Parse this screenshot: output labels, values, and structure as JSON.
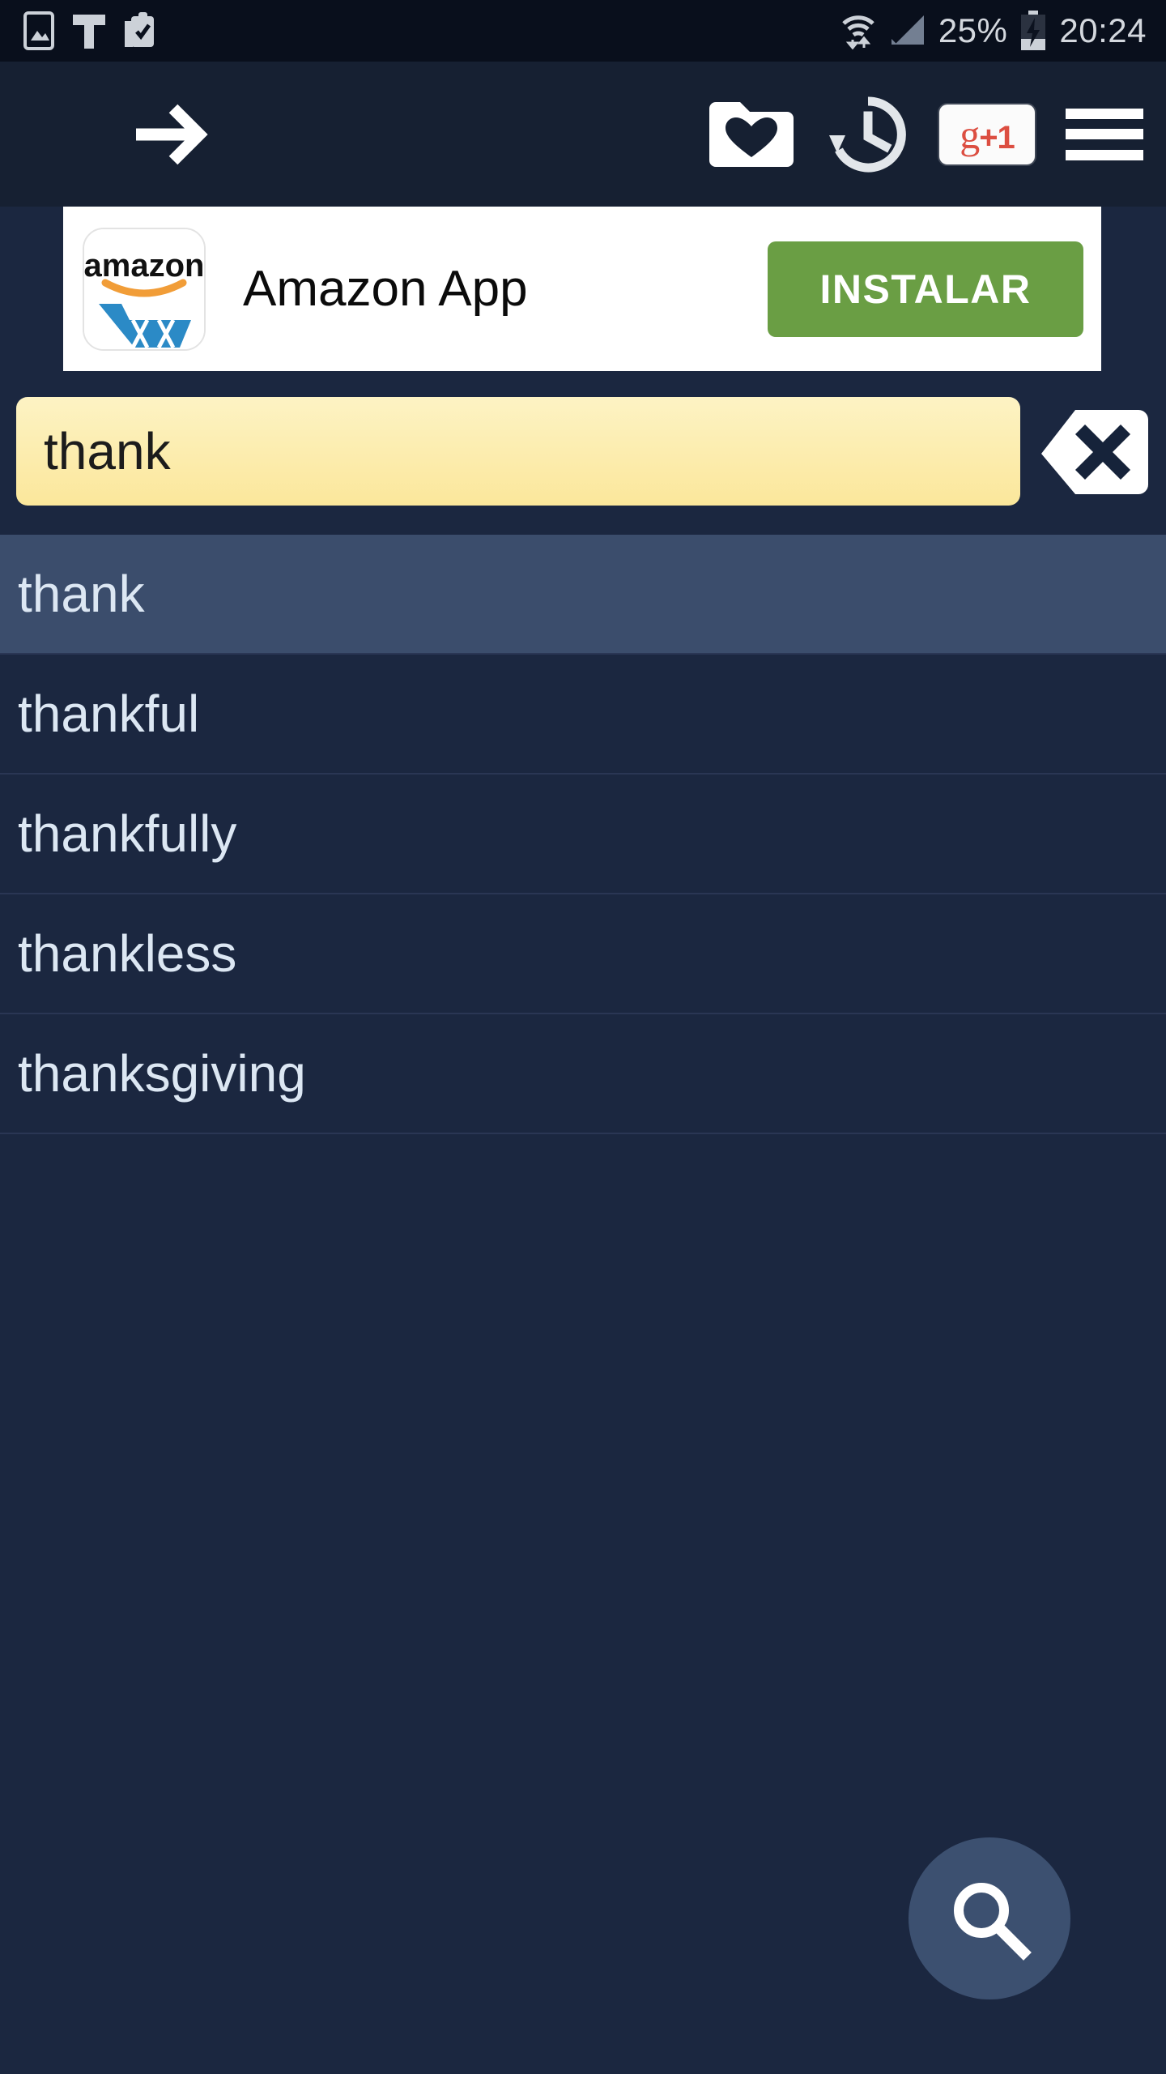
{
  "status_bar": {
    "icons_left": [
      "image-icon",
      "text-format-icon",
      "clipboard-check-icon"
    ],
    "wifi_icon": "wifi-icon",
    "signal_icon": "signal-bars-icon",
    "battery_percent": "25%",
    "battery_icon": "battery-charging-icon",
    "time": "20:24"
  },
  "toolbar": {
    "back_icon": "arrow-right-icon",
    "favorites_icon": "folder-heart-icon",
    "history_icon": "history-clock-icon",
    "gplus_g": "g",
    "gplus_plusone": "+1",
    "menu_icon": "hamburger-menu-icon"
  },
  "ad": {
    "icon_name": "amazon-app-icon",
    "icon_wordmark": "amazon",
    "title": "Amazon App",
    "install_label": "INSTALAR"
  },
  "search": {
    "value": "thank",
    "placeholder": "",
    "clear_icon": "backspace-clear-icon",
    "fab_icon": "magnifier-icon"
  },
  "suggestions": [
    {
      "label": "thank",
      "selected": true
    },
    {
      "label": "thankful",
      "selected": false
    },
    {
      "label": "thankfully",
      "selected": false
    },
    {
      "label": "thankless",
      "selected": false
    },
    {
      "label": "thanksgiving",
      "selected": false
    }
  ],
  "colors": {
    "status_bar_bg": "#090f1c",
    "toolbar_bg": "#162032",
    "page_bg": "#1b2740",
    "row_selected_bg": "#3b4d6c",
    "row_divider": "#2a3654",
    "suggestion_text": "#dce7f3",
    "search_field_bg": "#fbe79b",
    "install_green": "#6a9e44",
    "gplus_red": "#dc4e41",
    "fab_bg": "#3c5070"
  }
}
